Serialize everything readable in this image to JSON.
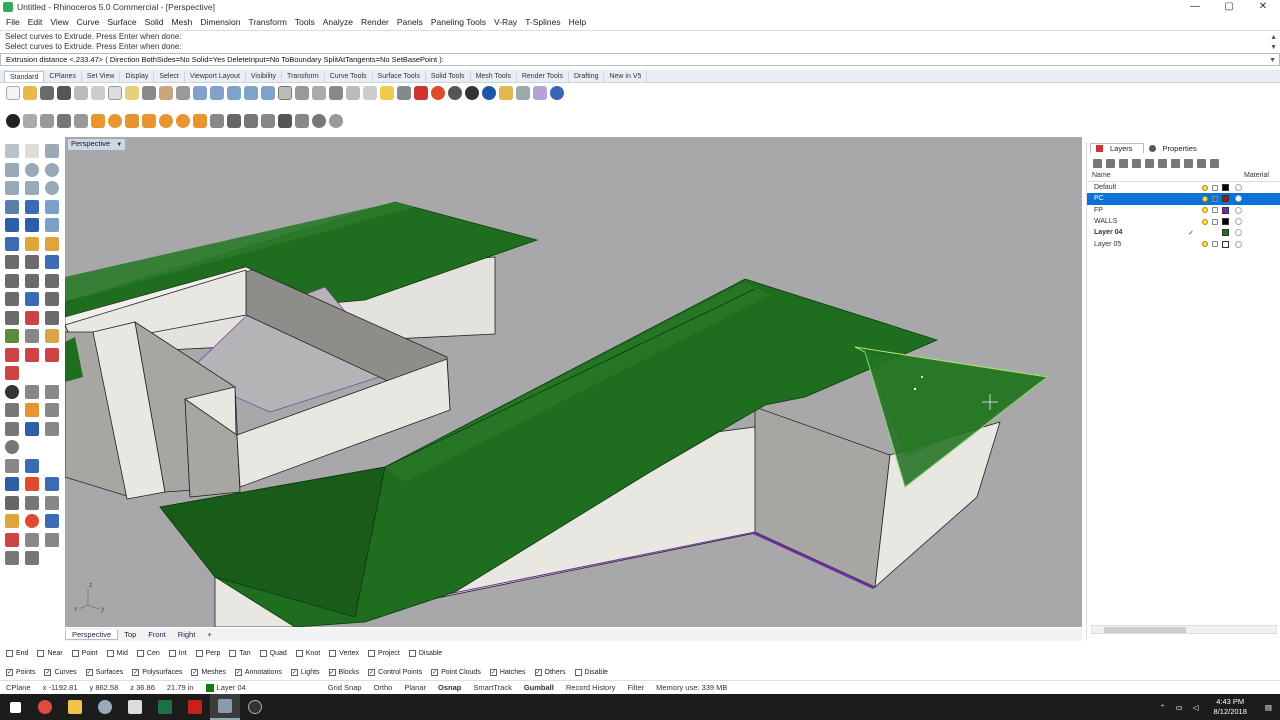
{
  "window": {
    "title": "Untitled - Rhinoceros 5.0 Commercial - [Perspective]",
    "buttons": [
      "—",
      "▢",
      "✕"
    ]
  },
  "menu": [
    "File",
    "Edit",
    "View",
    "Curve",
    "Surface",
    "Solid",
    "Mesh",
    "Dimension",
    "Transform",
    "Tools",
    "Analyze",
    "Render",
    "Panels",
    "Paneling Tools",
    "V-Ray",
    "T-Splines",
    "Help"
  ],
  "command_history": [
    "Select curves to Extrude. Press Enter when done:",
    "Select curves to Extrude. Press Enter when done:"
  ],
  "command_prompt": "Extrusion distance <.233.47> ( Direction  BothSides=No  Solid=Yes  DeleteInput=No  ToBoundary  SplitAtTangents=No  SetBasePoint ):",
  "toolbar_tabs": [
    "Standard",
    "CPlanes",
    "Set View",
    "Display",
    "Select",
    "Viewport Layout",
    "Visibility",
    "Transform",
    "Curve Tools",
    "Surface Tools",
    "Solid Tools",
    "Mesh Tools",
    "Render Tools",
    "Drafting",
    "New in V5"
  ],
  "viewport": {
    "label": "Perspective",
    "dropdown_glyph": "▼",
    "axes": {
      "x": "x",
      "y": "y",
      "z": "z"
    }
  },
  "viewport_tabs": [
    "Perspective",
    "Top",
    "Front",
    "Right"
  ],
  "viewport_tab_add": "+",
  "osnaps": [
    {
      "label": "End",
      "checked": false
    },
    {
      "label": "Near",
      "checked": false
    },
    {
      "label": "Point",
      "checked": false
    },
    {
      "label": "Mid",
      "checked": false
    },
    {
      "label": "Cen",
      "checked": false
    },
    {
      "label": "Int",
      "checked": false
    },
    {
      "label": "Perp",
      "checked": false
    },
    {
      "label": "Tan",
      "checked": false
    },
    {
      "label": "Quad",
      "checked": false
    },
    {
      "label": "Knot",
      "checked": false
    },
    {
      "label": "Vertex",
      "checked": false
    },
    {
      "label": "Project",
      "checked": false
    },
    {
      "label": "Disable",
      "checked": false
    }
  ],
  "filters": [
    {
      "label": "Points",
      "checked": true
    },
    {
      "label": "Curves",
      "checked": true
    },
    {
      "label": "Surfaces",
      "checked": true
    },
    {
      "label": "Polysurfaces",
      "checked": true
    },
    {
      "label": "Meshes",
      "checked": true
    },
    {
      "label": "Annotations",
      "checked": true
    },
    {
      "label": "Lights",
      "checked": true
    },
    {
      "label": "Blocks",
      "checked": true
    },
    {
      "label": "Control Points",
      "checked": true
    },
    {
      "label": "Point Clouds",
      "checked": true
    },
    {
      "label": "Hatches",
      "checked": true
    },
    {
      "label": "Others",
      "checked": true
    },
    {
      "label": "Disable",
      "checked": false
    }
  ],
  "status": {
    "cplane": "CPlane",
    "x": "x -1192.81",
    "y": "y 862.58",
    "z": "z 36.86",
    "distance": "21.79 in",
    "layer": "Layer 04",
    "grid_snap": "Grid Snap",
    "ortho": "Ortho",
    "planar": "Planar",
    "osnap": "Osnap",
    "smarttrack": "SmartTrack",
    "gumball": "Gumball",
    "record_history": "Record History",
    "filter": "Filter",
    "memory": "Memory use: 339 MB"
  },
  "panel": {
    "tabs": [
      "Layers",
      "Properties"
    ],
    "columns": {
      "name": "Name",
      "material": "Material"
    },
    "layers": [
      {
        "name": "Default",
        "current": "",
        "color": "#000000",
        "selected": false,
        "bold": false
      },
      {
        "name": "PC",
        "current": "",
        "color": "#b01010",
        "selected": true,
        "bold": false
      },
      {
        "name": "FP",
        "current": "",
        "color": "#7a2aa8",
        "selected": false,
        "bold": false
      },
      {
        "name": "WALLS",
        "current": "",
        "color": "#000000",
        "selected": false,
        "bold": false
      },
      {
        "name": "Layer 04",
        "current": "✓",
        "color": "#117a11",
        "selected": false,
        "bold": true
      },
      {
        "name": "Layer 05",
        "current": "",
        "color": "#ffffff",
        "selected": false,
        "bold": false
      }
    ]
  },
  "taskbar": {
    "time": "4:43 PM",
    "date": "8/12/2018"
  },
  "colors": {
    "roof": "#1f6d1e",
    "roof_dark": "#17521a",
    "wall_light": "#e9e7e2",
    "wall_dark": "#a7a6a2",
    "viewport_bg": "#a8a8ab",
    "accent": "#0a72d8"
  }
}
